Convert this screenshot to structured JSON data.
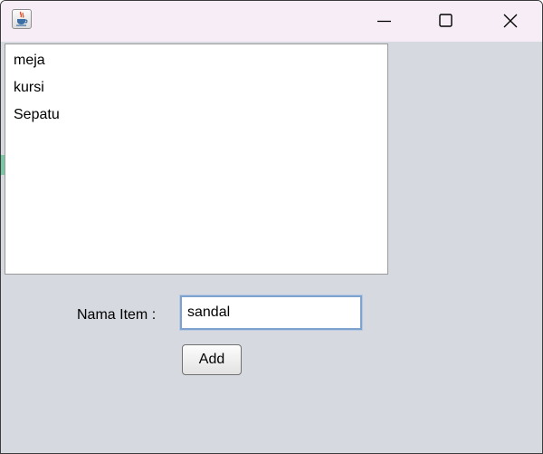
{
  "titlebar": {
    "app_icon": "java-coffee-cup-icon",
    "controls": [
      "minimize-icon",
      "maximize-icon",
      "close-icon"
    ]
  },
  "list": {
    "items": [
      "meja",
      "kursi",
      "Sepatu"
    ]
  },
  "form": {
    "name_label": "Nama Item :",
    "name_value": "sandal",
    "add_label": "Add"
  },
  "colors": {
    "titlebar_bg": "#f6edf6",
    "window_bg": "#d6d9e0",
    "input_focus_border": "#7da2ce"
  }
}
